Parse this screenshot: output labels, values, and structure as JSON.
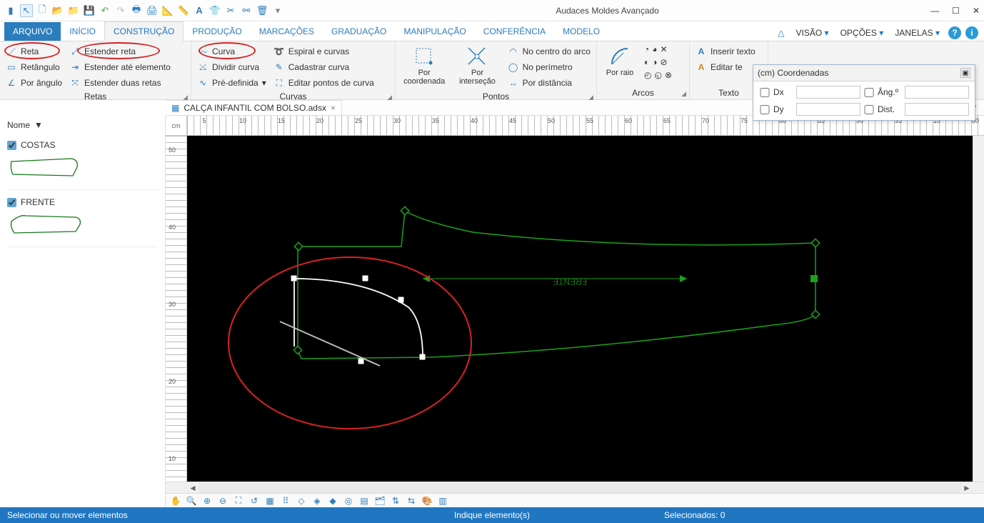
{
  "app": {
    "title": "Audaces Moldes Avançado"
  },
  "tabs": {
    "file": "ARQUIVO",
    "items": [
      "INÍCIO",
      "CONSTRUÇÃO",
      "PRODUÇÃO",
      "MARCAÇÕES",
      "GRADUAÇÃO",
      "MANIPULAÇÃO",
      "CONFERÊNCIA",
      "MODELO"
    ],
    "active": 1
  },
  "topright": {
    "visao": "VISÃO",
    "opcoes": "OPÇÕES",
    "janelas": "JANELAS"
  },
  "ribbon": {
    "retas": {
      "label": "Retas",
      "reta": "Reta",
      "retangulo": "Retângulo",
      "por_angulo": "Por ângulo",
      "estender_reta": "Estender reta",
      "estender_ate": "Estender até elemento",
      "estender_duas": "Estender duas retas"
    },
    "curvas": {
      "label": "Curvas",
      "curva": "Curva",
      "dividir": "Dividir curva",
      "pre": "Pré-definida",
      "espiral": "Espiral e curvas",
      "cadastrar": "Cadastrar curva",
      "editar": "Editar pontos de curva"
    },
    "pontos": {
      "label": "Pontos",
      "por_coordenada": "Por coordenada",
      "por_intersecao": "Por interseção",
      "no_centro": "No centro do arco",
      "no_perimetro": "No perímetro",
      "por_distancia": "Por distância"
    },
    "arcos": {
      "label": "Arcos",
      "por_raio": "Por raio"
    },
    "texto": {
      "label": "Texto",
      "inserir": "Inserir texto",
      "editar": "Editar te"
    }
  },
  "doc": {
    "name": "CALÇA INFANTIL COM BOLSO.adsx"
  },
  "side": {
    "hdr": "Nome",
    "pieces": [
      {
        "name": "COSTAS",
        "checked": true
      },
      {
        "name": "FRENTE",
        "checked": true
      }
    ]
  },
  "ruler": {
    "unit": "cm",
    "h": [
      "5",
      "10",
      "15",
      "20",
      "25",
      "30",
      "35",
      "40",
      "45",
      "50",
      "55",
      "60",
      "65",
      "70",
      "75",
      "80",
      "85",
      "90",
      "95",
      "10",
      "80"
    ],
    "v": [
      "50",
      "40",
      "30",
      "20",
      "10"
    ]
  },
  "canvas": {
    "piece_label": "FRENTE"
  },
  "coord": {
    "title": "(cm) Coordenadas",
    "dx": "Dx",
    "dy": "Dy",
    "ang": "Âng.º",
    "dist": "Dist."
  },
  "status": {
    "left": "Selecionar ou mover elementos",
    "mid": "Indique elemento(s)",
    "sel": "Selecionados: 0"
  }
}
